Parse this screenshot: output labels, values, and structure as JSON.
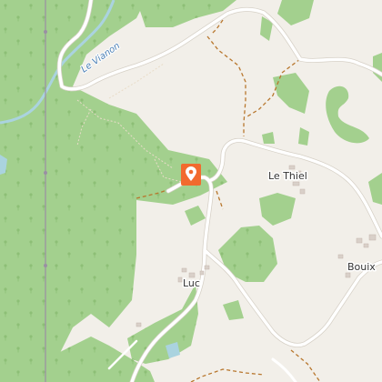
{
  "map": {
    "place_labels": {
      "le_thiel": "Le Thiel",
      "luc": "Luc",
      "bouix": "Bouix"
    },
    "river_name": "Le Vianon",
    "marker": {
      "icon": "location-pin-icon",
      "color": "#f26a2e"
    },
    "colors": {
      "land": "#f2efe9",
      "forest": "#a3d08e",
      "water": "#aad3df",
      "road": "#ffffff",
      "track": "#b8772e",
      "boundary": "#9a8fa3"
    }
  }
}
